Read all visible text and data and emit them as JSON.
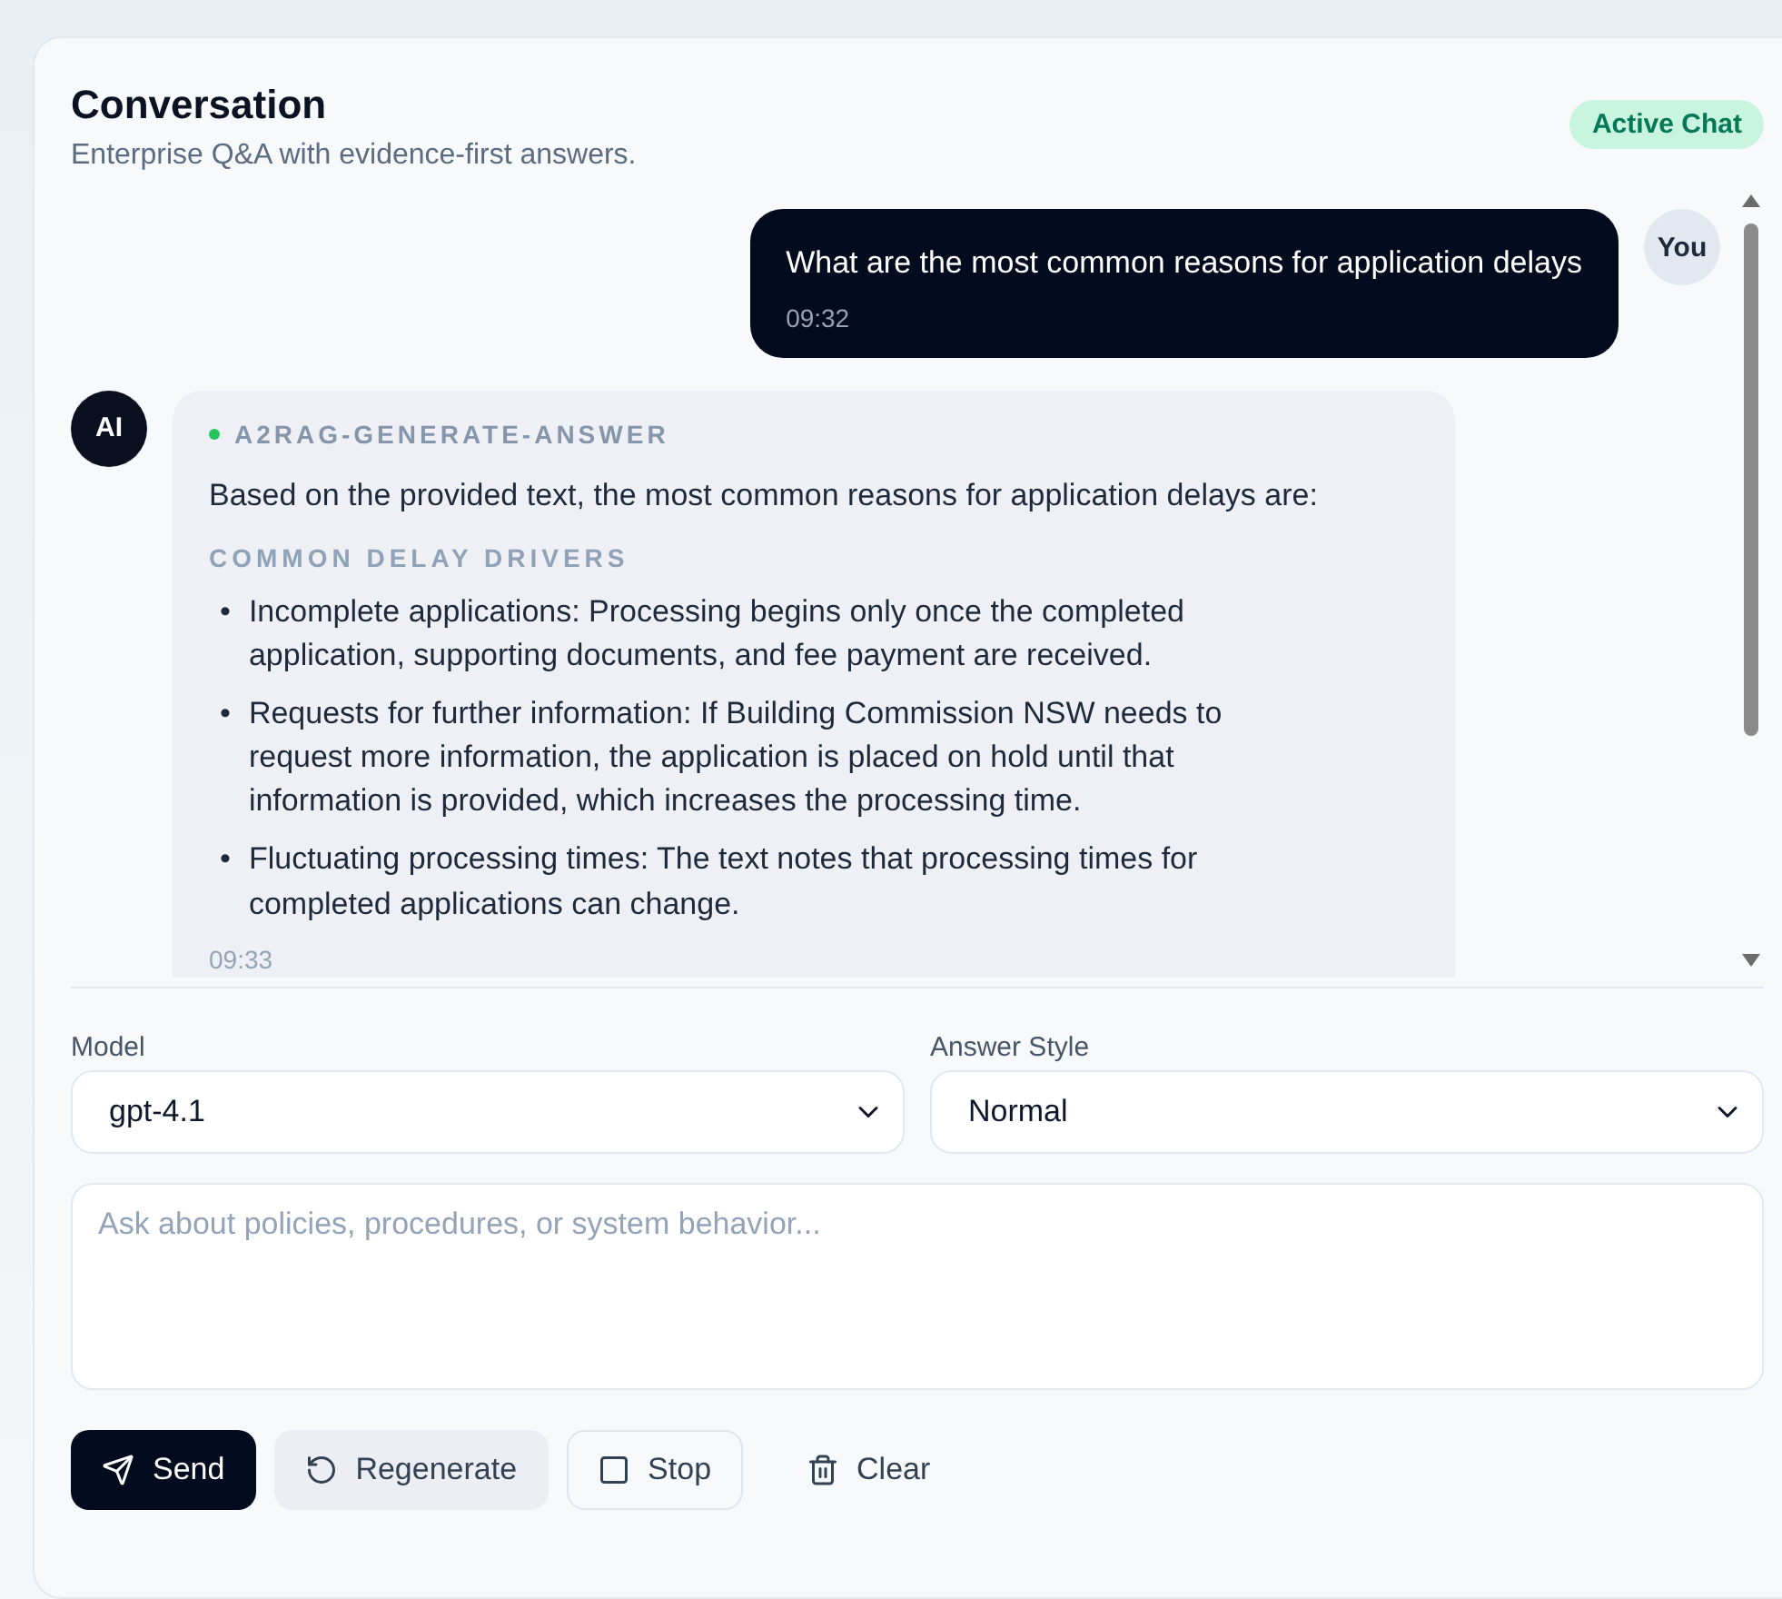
{
  "header": {
    "title": "Conversation",
    "subtitle": "Enterprise Q&A with evidence-first answers.",
    "badge": "Active Chat"
  },
  "messages": [
    {
      "kind": "user",
      "avatar": "You",
      "text": "What are the most common reasons for application delays",
      "time": "09:32"
    },
    {
      "kind": "assistant",
      "avatar": "AI",
      "source": "A2RAG-GENERATE-ANSWER",
      "intro": "Based on the provided text, the most common reasons for application delays are:",
      "section": "COMMON DELAY DRIVERS",
      "bullets": [
        {
          "marker": "•",
          "text": "Incomplete applications: Processing begins only once the completed application, supporting documents, and fee payment are received."
        },
        {
          "marker": "•",
          "text": "Requests for further information: If Building Commission NSW needs to request more information, the application is placed on hold until that information is provided, which increases the processing time."
        },
        {
          "marker": "•",
          "text": "Fluctuating processing times: The text notes that processing times for completed applications can change."
        }
      ],
      "time": "09:33"
    }
  ],
  "controls": [
    {
      "label": "Model",
      "value": "gpt-4.1"
    },
    {
      "label": "Answer Style",
      "value": "Normal"
    }
  ],
  "composer": {
    "placeholder": "Ask about policies, procedures, or system behavior..."
  },
  "actions": [
    {
      "kind": "send",
      "label": "Send"
    },
    {
      "kind": "regenerate",
      "label": "Regenerate"
    },
    {
      "kind": "stop",
      "label": "Stop"
    },
    {
      "kind": "clear",
      "label": "Clear"
    }
  ]
}
